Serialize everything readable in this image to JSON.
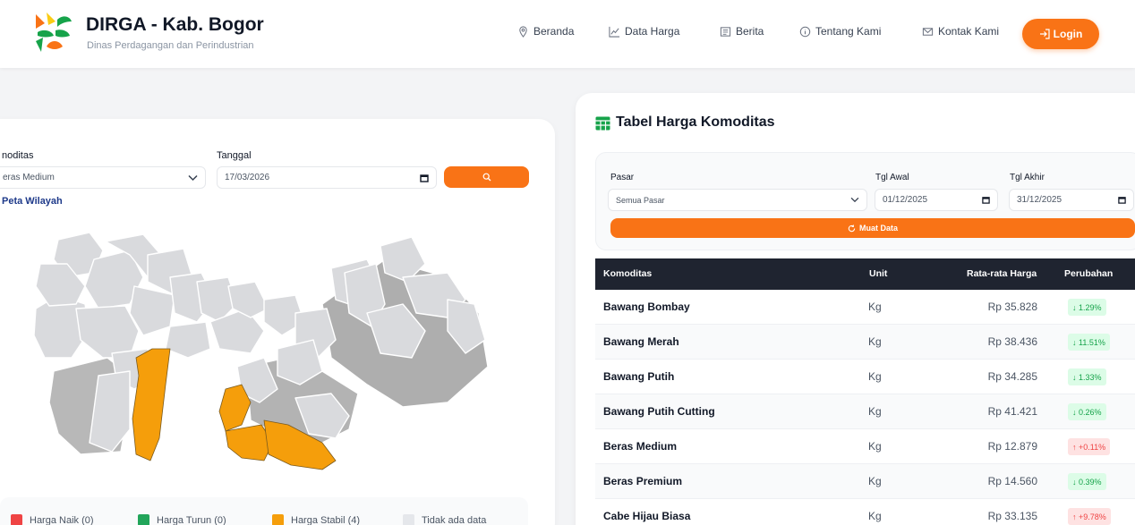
{
  "header": {
    "title": "DIRGA - Kab. Bogor",
    "subtitle": "Dinas Perdagangan dan Perindustrian",
    "nav": [
      {
        "label": "Beranda",
        "icon": "location-pin-icon"
      },
      {
        "label": "Data Harga",
        "icon": "chart-line-icon"
      },
      {
        "label": "Berita",
        "icon": "newspaper-icon"
      },
      {
        "label": "Tentang Kami",
        "icon": "info-icon"
      },
      {
        "label": "Kontak Kami",
        "icon": "mail-icon"
      }
    ],
    "login_label": "Login"
  },
  "map_panel": {
    "komoditas_label": "noditas",
    "komoditas_value": "eras Medium",
    "tanggal_label": "Tanggal",
    "tanggal_value": "17/03/2026",
    "map_title": "Peta Wilayah",
    "legend": [
      {
        "label": "Harga Naik (0)",
        "color": "#ef4444"
      },
      {
        "label": "Harga Turun (0)",
        "color": "#22a55a"
      },
      {
        "label": "Harga Stabil (4)",
        "color": "#f59e0b"
      },
      {
        "label": "Tidak ada data",
        "color": "#e5e7eb"
      }
    ]
  },
  "table_panel": {
    "title": "Tabel Harga Komoditas",
    "pasar_label": "Pasar",
    "pasar_value": "Semua Pasar",
    "tgl_awal_label": "Tgl Awal",
    "tgl_awal_value": "01/12/2025",
    "tgl_akhir_label": "Tgl Akhir",
    "tgl_akhir_value": "31/12/2025",
    "load_label": "Muat Data",
    "columns": [
      "Komoditas",
      "Unit",
      "Rata-rata Harga",
      "Perubahan"
    ],
    "rows": [
      {
        "name": "Bawang Bombay",
        "unit": "Kg",
        "price": "Rp 35.828",
        "change": "↓ 1.29%",
        "dir": "down"
      },
      {
        "name": "Bawang Merah",
        "unit": "Kg",
        "price": "Rp 38.436",
        "change": "↓ 11.51%",
        "dir": "down"
      },
      {
        "name": "Bawang Putih",
        "unit": "Kg",
        "price": "Rp 34.285",
        "change": "↓ 1.33%",
        "dir": "down"
      },
      {
        "name": "Bawang Putih Cutting",
        "unit": "Kg",
        "price": "Rp 41.421",
        "change": "↓ 0.26%",
        "dir": "down"
      },
      {
        "name": "Beras Medium",
        "unit": "Kg",
        "price": "Rp 12.879",
        "change": "↑ +0.11%",
        "dir": "up"
      },
      {
        "name": "Beras Premium",
        "unit": "Kg",
        "price": "Rp 14.560",
        "change": "↓ 0.39%",
        "dir": "down"
      },
      {
        "name": "Cabe Hijau Biasa",
        "unit": "Kg",
        "price": "Rp 33.135",
        "change": "↑ +9.78%",
        "dir": "up"
      }
    ]
  },
  "colors": {
    "accent": "#f97316",
    "table_header": "#1f2430",
    "map_stable": "#f59e0b",
    "map_nodata": "#e5e7eb"
  }
}
